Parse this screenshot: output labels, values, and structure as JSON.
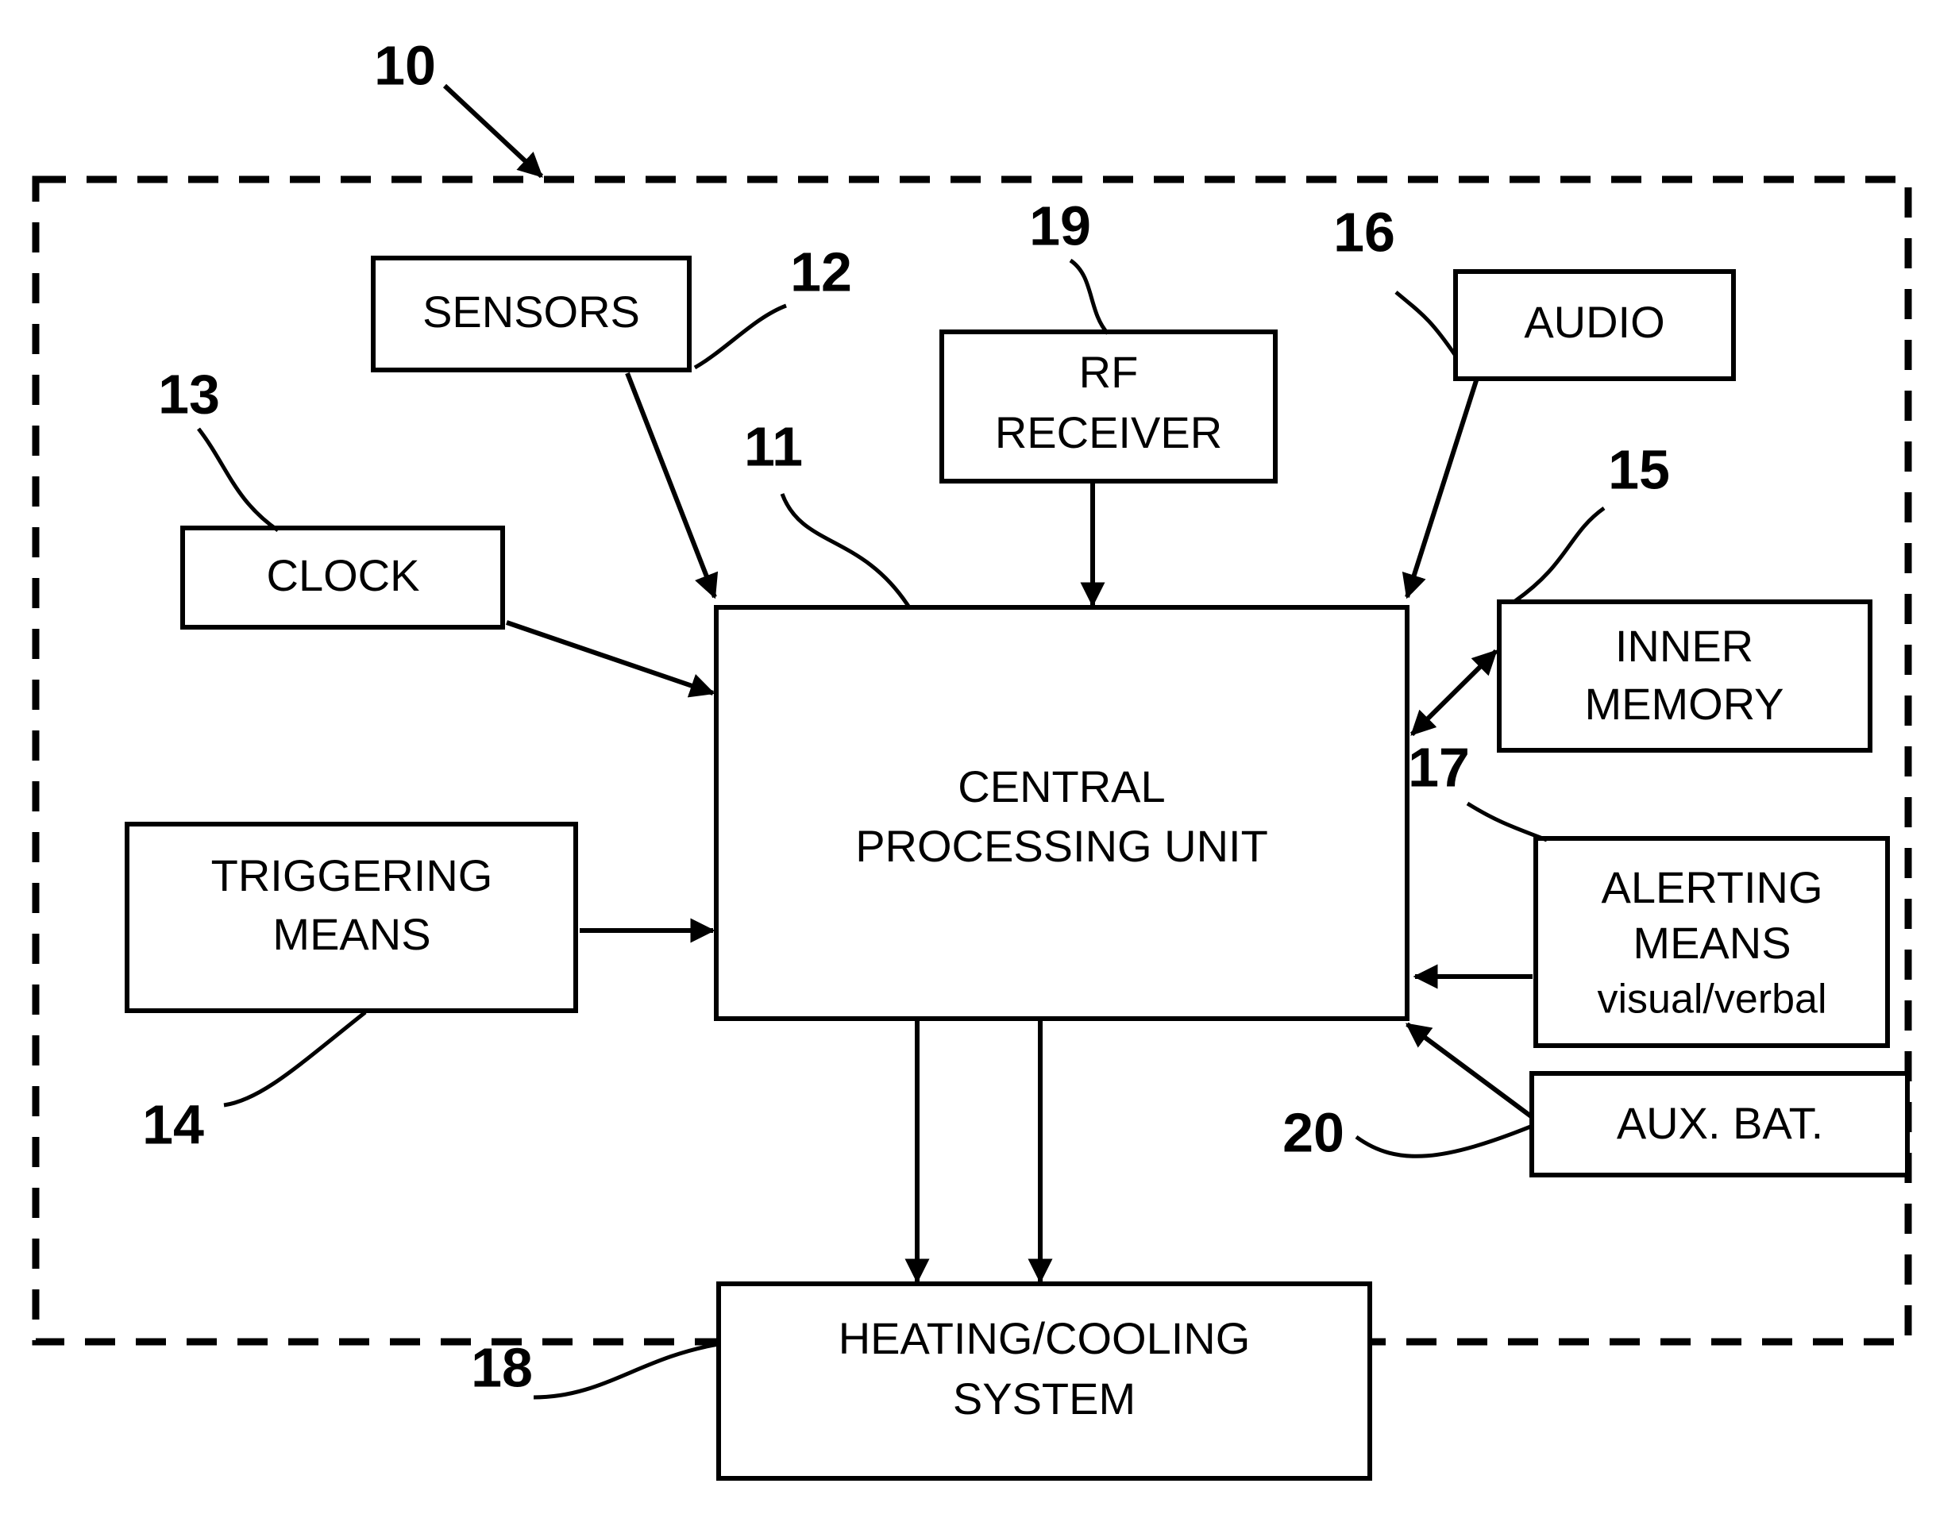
{
  "figure": {
    "type": "patent-block-diagram",
    "enclosure_ref": "10",
    "blocks": [
      {
        "id": "sensors",
        "label_line1": "SENSORS",
        "label_line2": "",
        "label_line3": "",
        "ref": "12"
      },
      {
        "id": "clock",
        "label_line1": "CLOCK",
        "label_line2": "",
        "label_line3": "",
        "ref": "13"
      },
      {
        "id": "triggering",
        "label_line1": "TRIGGERING",
        "label_line2": "MEANS",
        "label_line3": "",
        "ref": "14"
      },
      {
        "id": "cpu",
        "label_line1": "CENTRAL",
        "label_line2": "PROCESSING UNIT",
        "label_line3": "",
        "ref": "11"
      },
      {
        "id": "rf_receiver",
        "label_line1": "RF",
        "label_line2": "RECEIVER",
        "label_line3": "",
        "ref": "19"
      },
      {
        "id": "audio",
        "label_line1": "AUDIO",
        "label_line2": "",
        "label_line3": "",
        "ref": "16"
      },
      {
        "id": "inner_memory",
        "label_line1": "INNER",
        "label_line2": "MEMORY",
        "label_line3": "",
        "ref": "15"
      },
      {
        "id": "alerting",
        "label_line1": "ALERTING",
        "label_line2": "MEANS",
        "label_line3": "visual/verbal",
        "ref": "17"
      },
      {
        "id": "aux_bat",
        "label_line1": "AUX. BAT.",
        "label_line2": "",
        "label_line3": "",
        "ref": "20"
      },
      {
        "id": "heating_cooling",
        "label_line1": "HEATING/COOLING",
        "label_line2": "SYSTEM",
        "label_line3": "",
        "ref": "18"
      }
    ],
    "reference_numerals": {
      "enclosure": "10",
      "cpu": "11",
      "sensors": "12",
      "clock": "13",
      "triggering": "14",
      "inner_memory": "15",
      "audio": "16",
      "alerting": "17",
      "heating_cooling": "18",
      "rf_receiver": "19",
      "aux_bat": "20"
    },
    "colors": {
      "line": "#000000",
      "background": "#ffffff"
    }
  }
}
